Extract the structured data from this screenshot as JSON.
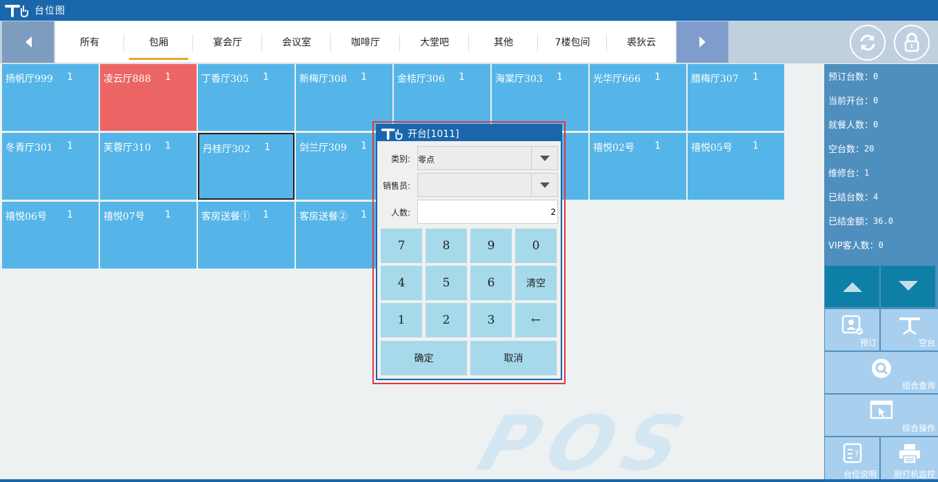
{
  "window": {
    "title": "台位图"
  },
  "tabs": [
    "所有",
    "包厢",
    "宴会厅",
    "会议室",
    "咖啡厅",
    "大堂吧",
    "其他",
    "7楼包间",
    "裘狄云"
  ],
  "active_tab": "包厢",
  "tables": [
    {
      "name": "扬帆厅999",
      "count": "1"
    },
    {
      "name": "凌云厅888",
      "count": "1",
      "status": "occupied"
    },
    {
      "name": "丁香厅305",
      "count": "1"
    },
    {
      "name": "新梅厅308",
      "count": "1"
    },
    {
      "name": "金桔厅306",
      "count": "1"
    },
    {
      "name": "海棠厅303",
      "count": "1"
    },
    {
      "name": "光华厅666",
      "count": "1"
    },
    {
      "name": "腊梅厅307",
      "count": "1"
    },
    {
      "name": "冬青厅301",
      "count": "1"
    },
    {
      "name": "芙蓉厅310",
      "count": "1"
    },
    {
      "name": "丹桂厅302",
      "count": "1",
      "status": "selected"
    },
    {
      "name": "剑兰厅309",
      "count": "1"
    },
    {
      "name": "",
      "count": ""
    },
    {
      "name": "",
      "count": ""
    },
    {
      "name": "禧悦02号",
      "count": "1"
    },
    {
      "name": "禧悦05号",
      "count": "1"
    },
    {
      "name": "禧悦06号",
      "count": "1"
    },
    {
      "name": "禧悦07号",
      "count": "1"
    },
    {
      "name": "客房送餐①",
      "count": "1"
    },
    {
      "name": "客房送餐②",
      "count": "1"
    }
  ],
  "stats": [
    {
      "label": "预订台数：",
      "value": "0"
    },
    {
      "label": "当前开台：",
      "value": "0"
    },
    {
      "label": "就餐人数：",
      "value": "0"
    },
    {
      "label": "空台数：",
      "value": "20"
    },
    {
      "label": "维修台：",
      "value": "1"
    },
    {
      "label": "已结台数：",
      "value": "4"
    },
    {
      "label": "已结金额：",
      "value": "36.0"
    },
    {
      "label": "VIP客人数：",
      "value": "0"
    }
  ],
  "actions": {
    "reserve": "预订",
    "empty": "空台",
    "combo_query": "组合查询",
    "general_ops": "综合操作",
    "table_info": "台位说明",
    "printer_monitor": "厨打机监控"
  },
  "watermark": "POS",
  "dialog": {
    "title": "开台[1011]",
    "category_label": "类别:",
    "category_value": "零点",
    "salesperson_label": "销售员:",
    "salesperson_value": "",
    "people_label": "人数:",
    "people_value": "2",
    "keys": [
      "7",
      "8",
      "9",
      "0",
      "4",
      "5",
      "6",
      "清空",
      "1",
      "2",
      "3",
      "←"
    ],
    "confirm": "确定",
    "cancel": "取消"
  },
  "colors": {
    "title_bar": "#1a66aa",
    "table_free": "#55b5e8",
    "table_occupied": "#ec6565",
    "tab_underline": "#f0a030",
    "dialog_border": "#e53440"
  },
  "icons": [
    "logo-icon",
    "chevron-left-icon",
    "chevron-right-icon",
    "refresh-icon",
    "lock-icon",
    "arrow-up-icon",
    "arrow-down-icon",
    "reserve-icon",
    "empty-table-icon",
    "search-icon",
    "general-ops-icon",
    "table-info-icon",
    "printer-icon"
  ]
}
